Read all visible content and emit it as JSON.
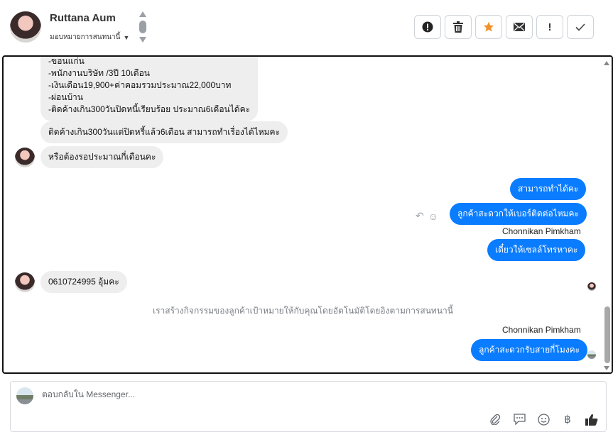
{
  "header": {
    "contact_name": "Ruttana Aum",
    "assign_label": "มอบหมายการสนทนานี้",
    "actions": [
      {
        "label": "!",
        "icon": "alert-circle-icon"
      },
      {
        "label": "",
        "icon": "trash-icon"
      },
      {
        "label": "",
        "icon": "star-icon"
      },
      {
        "label": "",
        "icon": "envelope-icon"
      },
      {
        "label": "!",
        "icon": "exclamation-icon"
      },
      {
        "label": "",
        "icon": "check-icon"
      }
    ]
  },
  "colors": {
    "outgoing_bubble": "#0a7cff",
    "incoming_bubble": "#eeeeee",
    "star": "#f0932b"
  },
  "messages": {
    "m1_lines": [
      "-ขอนแก่น",
      "-พนักงานบริษัท /3ปี 10เดือน",
      "-เงินเดือน19,900+ค่าคอมรวมประมาณ22,000บาท",
      "-ผ่อนบ้าน",
      "-ติดค้างเกิน300วันปิดหนี้เรียบร้อย ประมาณ6เดือนได้คะ"
    ],
    "m2": "ติดค้างเกิน300วันแต่ปิดหรี้แล้ว6เดือน สามารถทำเรื่องได้ไหมคะ",
    "m3": "หรือต้องรอประมาณกี่เดือนคะ",
    "m4": "สามารถทำได้คะ",
    "m5": "ลูกค้าสะดวกให้เบอร์ติดต่อไหมคะ",
    "sender_1": "Chonnikan Pimkham",
    "m6": "เดี๋ยวให้เซลล์โทรหาคะ",
    "m7": "0610724995 อุ้มคะ",
    "system_note": "เราสร้างกิจกรรมของลูกค้าเป้าหมายให้กับคุณโดยอัตโนมัติโดยอิงตามการสนทนานี้",
    "sender_2": "Chonnikan Pimkham",
    "m8": "ลูกค้าสะดวกรับสายกี่โมงคะ"
  },
  "composer": {
    "placeholder": "ตอบกลับใน Messenger...",
    "tools": [
      "paperclip-icon",
      "chat-icon",
      "emoji-icon",
      "baht-icon",
      "thumbs-up-icon"
    ]
  }
}
